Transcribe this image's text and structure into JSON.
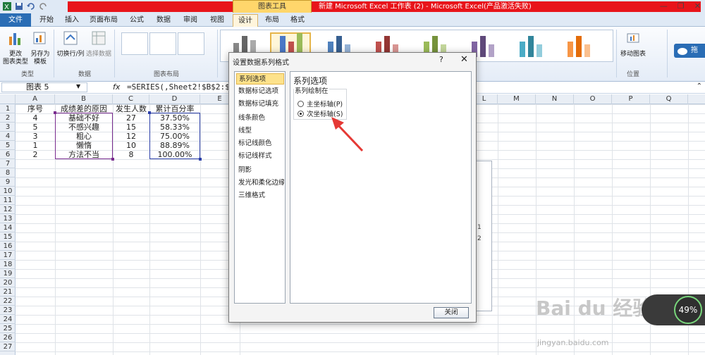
{
  "window": {
    "chart_tools_label": "图表工具",
    "title": "新建 Microsoft Excel 工作表 (2) - Microsoft Excel(产品激活失败)"
  },
  "tabs": {
    "file": "文件",
    "items": [
      "开始",
      "插入",
      "页面布局",
      "公式",
      "数据",
      "审阅",
      "视图",
      "设计",
      "布局",
      "格式"
    ],
    "active": "设计"
  },
  "ribbon": {
    "change_type": "更改\n图表类型",
    "save_template": "另存为\n模板",
    "switch_row_col": "切换行/列",
    "select_data": "选择数据",
    "move_chart": "移动图表",
    "group_type": "类型",
    "group_data": "数据",
    "group_layout": "图表布局",
    "group_location": "位置",
    "extra": "拖"
  },
  "formula_bar": {
    "name_box": "图表 5",
    "fx": "fx",
    "formula": "=SERIES(,Sheet2!$B$2:$B$"
  },
  "columns": [
    "A",
    "B",
    "C",
    "D",
    "E",
    "L",
    "M",
    "N",
    "O",
    "P",
    "Q"
  ],
  "rows": [
    "1",
    "2",
    "3",
    "4",
    "5",
    "6",
    "7",
    "8",
    "9",
    "10",
    "11",
    "12",
    "13",
    "14",
    "15",
    "16",
    "17",
    "18",
    "19",
    "20",
    "21",
    "22",
    "23",
    "24",
    "25",
    "26",
    "27"
  ],
  "table": {
    "headers": [
      "序号",
      "成绩差的原因",
      "发生人数",
      "累计百分率"
    ],
    "rows": [
      [
        "4",
        "基础不好",
        "27",
        "37.50%"
      ],
      [
        "5",
        "不感兴趣",
        "15",
        "58.33%"
      ],
      [
        "3",
        "粗心",
        "12",
        "75.00%"
      ],
      [
        "1",
        "懒惰",
        "10",
        "88.89%"
      ],
      [
        "2",
        "方法不当",
        "8",
        "100.00%"
      ]
    ]
  },
  "dialog": {
    "title": "设置数据系列格式",
    "help": "?",
    "close": "✕",
    "nav_items": [
      "系列选项",
      "数据标记选项",
      "数据标记填充",
      "线条颜色",
      "线型",
      "标记线颜色",
      "标记线样式",
      "阴影",
      "发光和柔化边缘",
      "三维格式"
    ],
    "selected_nav": "系列选项",
    "panel_title": "系列选项",
    "plot_on_label": "系列绘制在",
    "primary_axis": "主坐标轴(P)",
    "secondary_axis": "次坐标轴(S)",
    "secondary_selected": true,
    "close_button": "关闭"
  },
  "legend_peek": [
    "1",
    "2"
  ],
  "watermark": {
    "text": "Bai du 经验",
    "url": "jingyan.baidu.com"
  },
  "speed_widget": {
    "percent": "49%"
  }
}
